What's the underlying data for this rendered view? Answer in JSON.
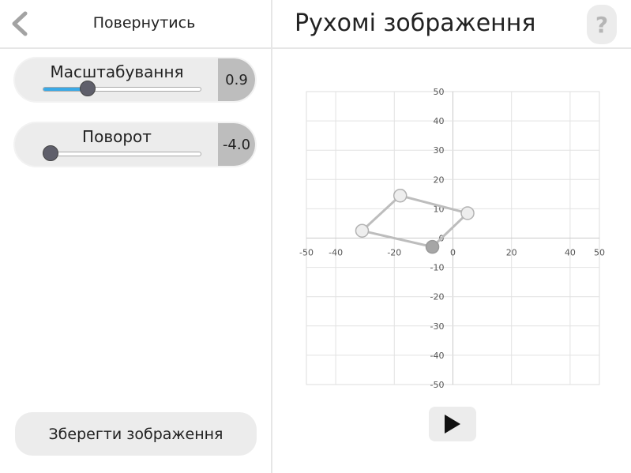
{
  "header": {
    "back_label": "Повернутись",
    "title": "Рухомі зображення"
  },
  "icons": {
    "back": "chevron-left-icon",
    "help": "question-mark-icon",
    "play": "play-icon"
  },
  "sliders": [
    {
      "label": "Масштабування",
      "value": "0.9",
      "fraction": 0.28
    },
    {
      "label": "Поворот",
      "value": "-4.0",
      "fraction": 0.0
    }
  ],
  "actions": {
    "save_label": "Зберегти зображення",
    "help_label": "?"
  },
  "colors": {
    "accent": "#3aa9e6",
    "button_bg": "#ececec",
    "value_bg": "#bdbdbd",
    "knob": "#5f5f6b",
    "shape_stroke": "#bdbdbd"
  },
  "chart_data": {
    "type": "scatter",
    "xlim": [
      -50,
      50
    ],
    "ylim": [
      -50,
      50
    ],
    "grid": true,
    "x_ticks": [
      -50,
      -40,
      -20,
      0,
      20,
      40,
      50
    ],
    "y_ticks": [
      50,
      40,
      30,
      20,
      10,
      0,
      -10,
      -20,
      -30,
      -40,
      -50
    ],
    "polygon_closed": true,
    "points": [
      {
        "x": -18,
        "y": 14.5
      },
      {
        "x": 5,
        "y": 8.5
      },
      {
        "x": -7,
        "y": -3
      },
      {
        "x": -31,
        "y": 2.5
      }
    ],
    "active_point_index": 2
  }
}
